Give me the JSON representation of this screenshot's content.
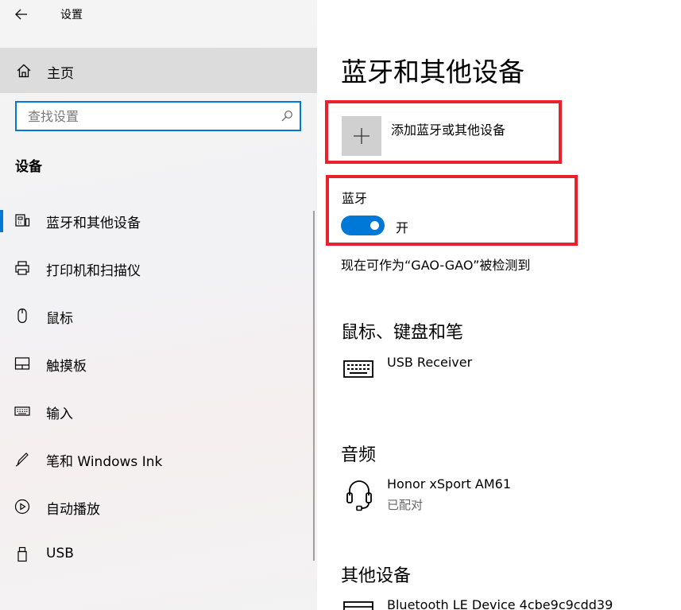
{
  "app": {
    "title": "设置"
  },
  "sidebar": {
    "home_label": "主页",
    "search": {
      "placeholder": "查找设置",
      "value": ""
    },
    "section_heading": "设备",
    "items": [
      {
        "label": "蓝牙和其他设备",
        "icon": "bluetooth-devices-icon",
        "selected": true
      },
      {
        "label": "打印机和扫描仪",
        "icon": "printer-icon"
      },
      {
        "label": "鼠标",
        "icon": "mouse-icon"
      },
      {
        "label": "触摸板",
        "icon": "touchpad-icon"
      },
      {
        "label": "输入",
        "icon": "keyboard-icon"
      },
      {
        "label": "笔和 Windows Ink",
        "icon": "pen-icon"
      },
      {
        "label": "自动播放",
        "icon": "autoplay-icon"
      },
      {
        "label": "USB",
        "icon": "usb-icon"
      }
    ]
  },
  "main": {
    "page_title": "蓝牙和其他设备",
    "add_device_label": "添加蓝牙或其他设备",
    "bluetooth": {
      "label": "蓝牙",
      "state_label": "开",
      "on": true
    },
    "discoverable_text": "现在可作为“GAO-GAO”被检测到",
    "groups": [
      {
        "heading": "鼠标、键盘和笔",
        "devices": [
          {
            "name": "USB Receiver",
            "status": "",
            "icon": "keyboard-icon"
          }
        ]
      },
      {
        "heading": "音频",
        "devices": [
          {
            "name": "Honor xSport AM61",
            "status": "已配对",
            "icon": "headset-icon"
          }
        ]
      },
      {
        "heading": "其他设备",
        "devices": [
          {
            "name": "Bluetooth LE Device 4cbe9c9cdd39",
            "status": "",
            "icon": "device-icon"
          }
        ]
      }
    ]
  },
  "colors": {
    "accent": "#0078d7",
    "highlight_box": "#e8212a",
    "selected_bg": "#dcdcdc"
  }
}
